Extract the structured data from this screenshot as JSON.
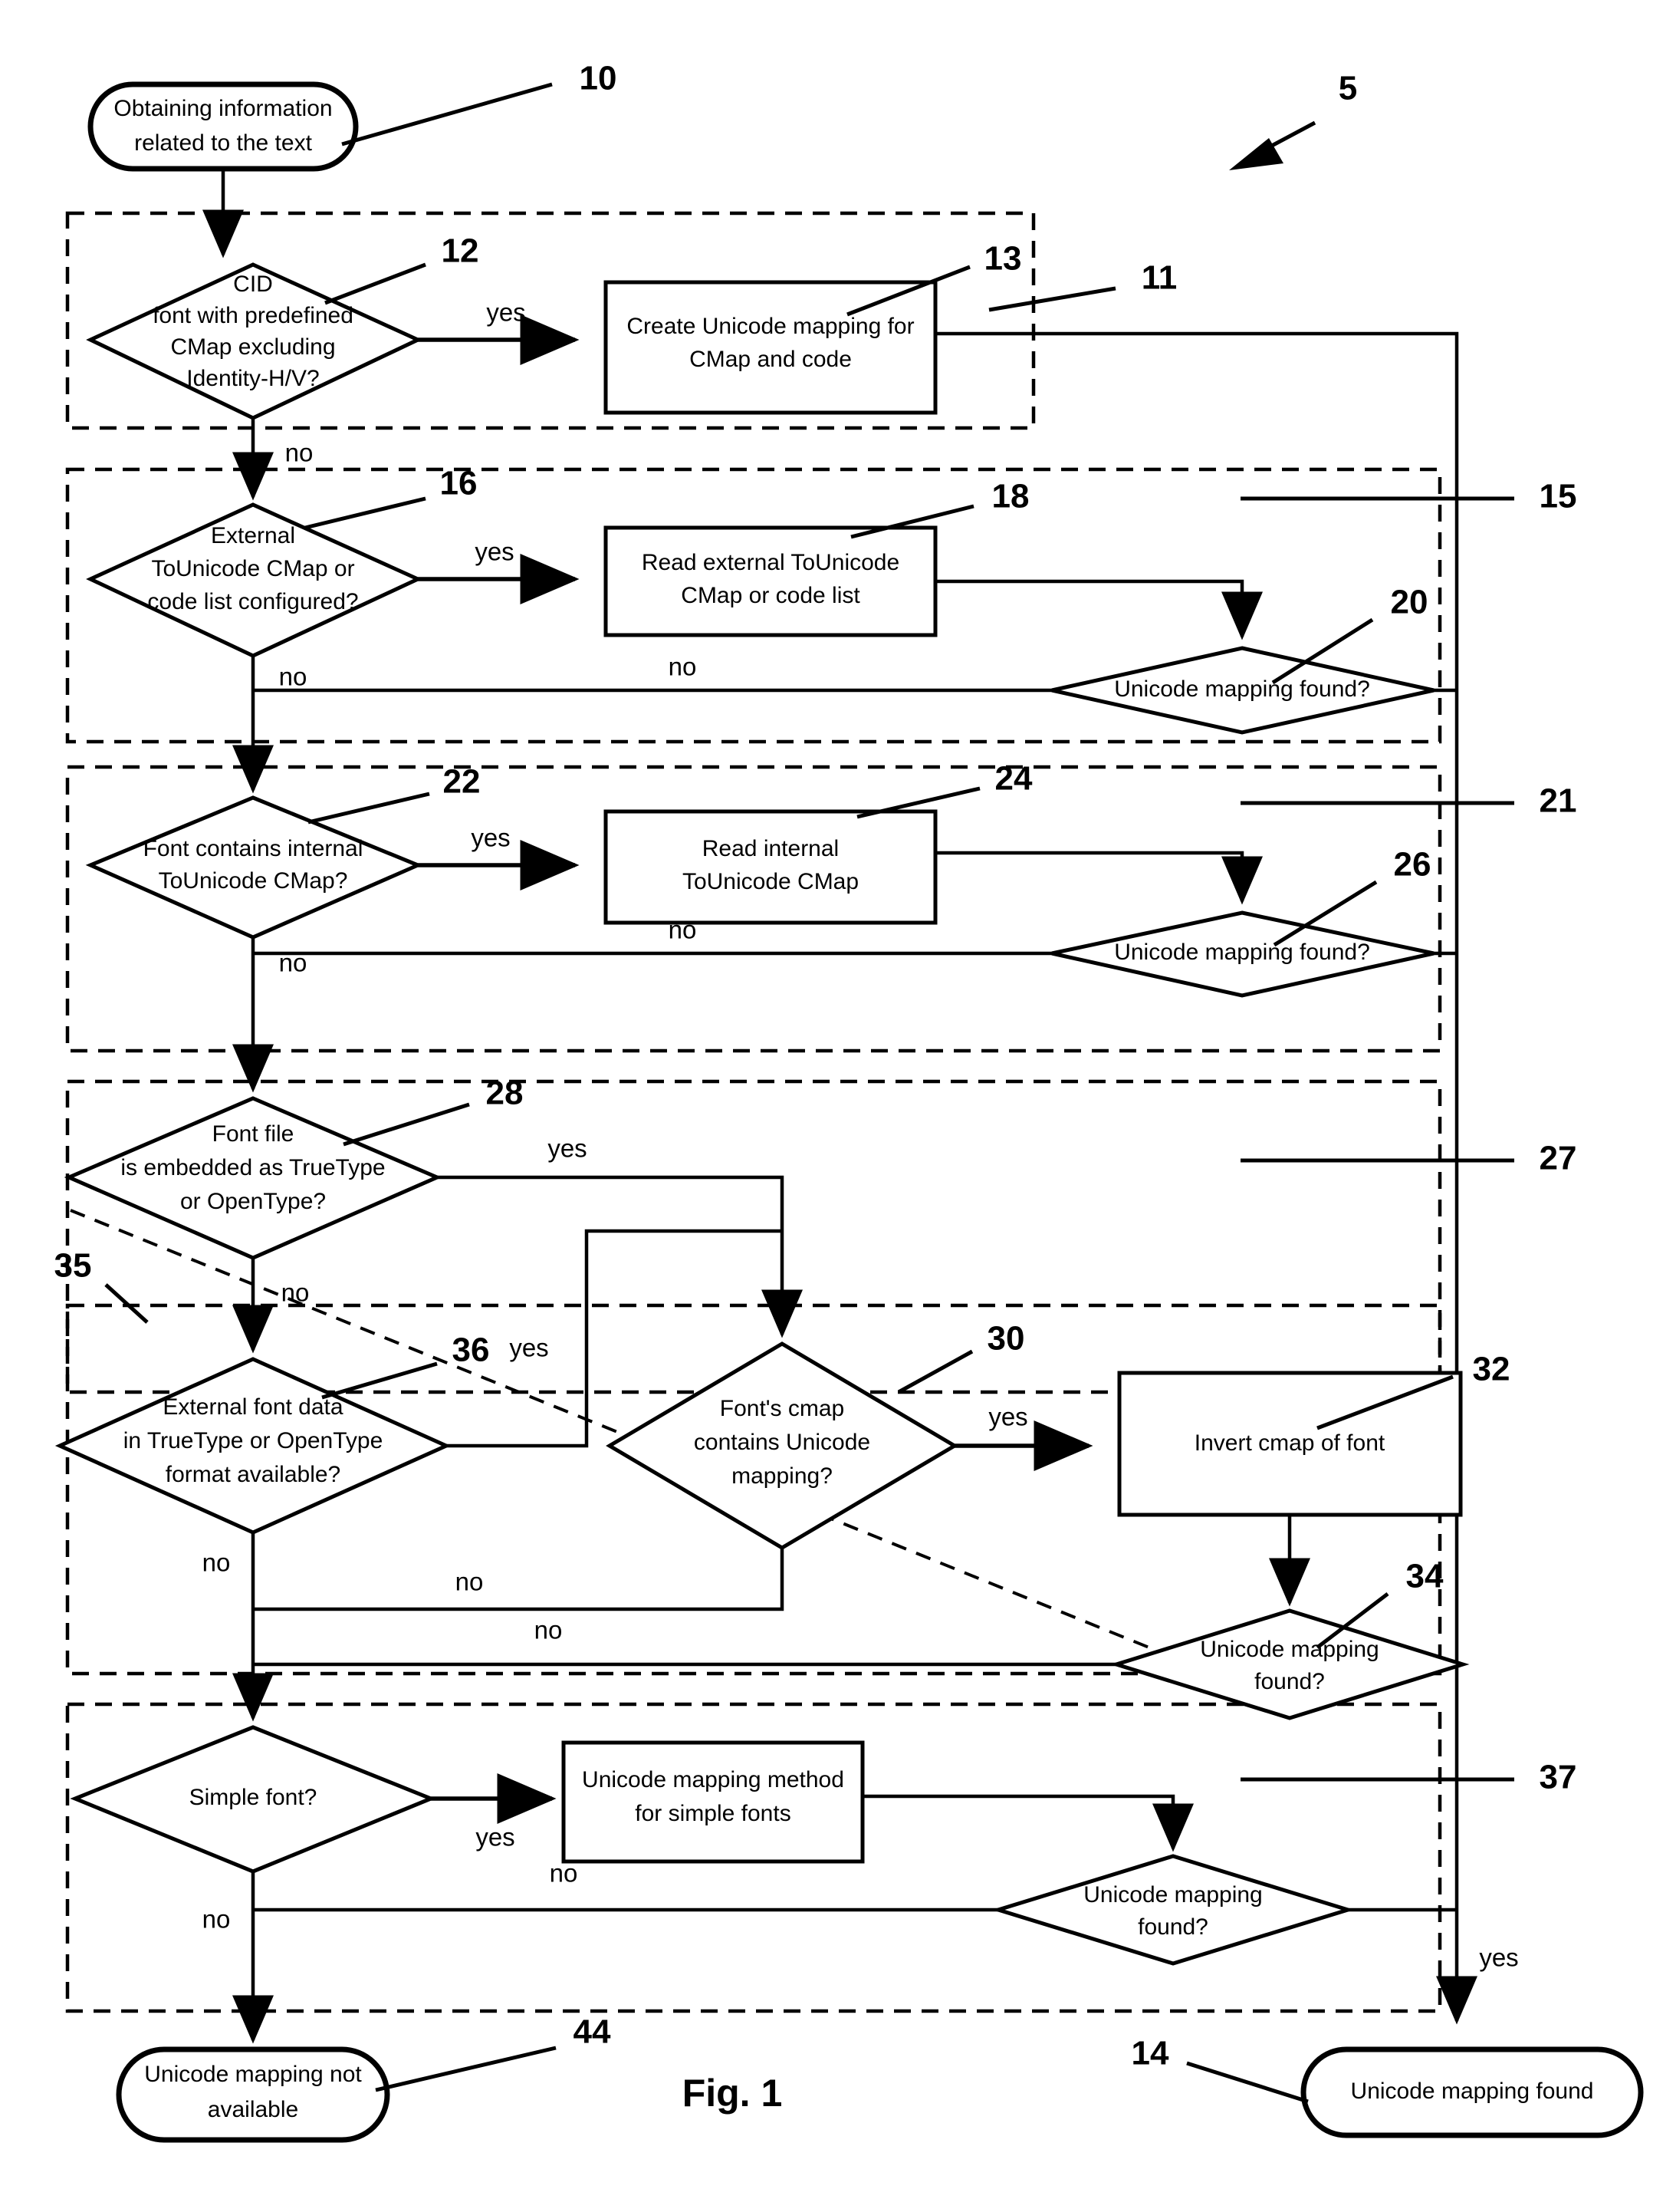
{
  "figure": {
    "caption": "Fig. 1",
    "overall_ref": "5"
  },
  "terminators": [
    {
      "id": "start",
      "ref": "10",
      "lines": [
        "Obtaining information",
        "related to the text"
      ]
    },
    {
      "id": "fail",
      "ref": "44",
      "lines": [
        "Unicode mapping not",
        "available"
      ]
    },
    {
      "id": "success",
      "ref": "14",
      "lines": [
        "Unicode mapping found"
      ]
    }
  ],
  "decisions": [
    {
      "id": "cid",
      "ref": "12",
      "lines": [
        "CID",
        "font with predefined",
        "CMap excluding",
        "Identity-H/V?"
      ]
    },
    {
      "id": "external_cmap",
      "ref": "16",
      "lines": [
        "External",
        "ToUnicode CMap or",
        "code list configured?"
      ]
    },
    {
      "id": "found_20",
      "ref": "20",
      "lines": [
        "Unicode mapping found?"
      ]
    },
    {
      "id": "internal_cmap",
      "ref": "22",
      "lines": [
        "Font contains internal",
        "ToUnicode CMap?"
      ]
    },
    {
      "id": "found_26",
      "ref": "26",
      "lines": [
        "Unicode mapping found?"
      ]
    },
    {
      "id": "embedded",
      "ref": "28",
      "lines": [
        "Font file",
        "is  embedded as  TrueType",
        "or OpenType?"
      ]
    },
    {
      "id": "external_font_data",
      "ref": "36",
      "lines": [
        "External font data",
        "in TrueType or OpenType",
        "format  available?"
      ]
    },
    {
      "id": "font_cmap",
      "ref": "30",
      "lines": [
        "Font's cmap",
        "contains Unicode",
        "mapping?"
      ]
    },
    {
      "id": "found_34",
      "ref": "34",
      "lines": [
        "Unicode mapping",
        "found?"
      ]
    },
    {
      "id": "simple_font",
      "ref": "",
      "lines": [
        "Simple font?"
      ]
    },
    {
      "id": "found_simple",
      "ref": "",
      "lines": [
        "Unicode mapping",
        "found?"
      ]
    }
  ],
  "processes": [
    {
      "id": "create_mapping",
      "ref": "13",
      "lines": [
        "Create Unicode mapping for",
        "CMap and code"
      ]
    },
    {
      "id": "read_external",
      "ref": "18",
      "lines": [
        "Read external ToUnicode",
        "CMap or code list"
      ]
    },
    {
      "id": "read_internal",
      "ref": "24",
      "lines": [
        "Read internal",
        "ToUnicode CMap"
      ]
    },
    {
      "id": "invert_cmap",
      "ref": "32",
      "lines": [
        "Invert cmap of font"
      ]
    },
    {
      "id": "simple_method",
      "ref": "",
      "lines": [
        "Unicode mapping method",
        "for simple fonts"
      ]
    }
  ],
  "group_refs": [
    {
      "id": "group-11",
      "ref": "11"
    },
    {
      "id": "group-15",
      "ref": "15"
    },
    {
      "id": "group-21",
      "ref": "21"
    },
    {
      "id": "group-27",
      "ref": "27"
    },
    {
      "id": "group-35",
      "ref": "35"
    },
    {
      "id": "group-37",
      "ref": "37"
    }
  ],
  "edge_labels": {
    "yes": "yes",
    "no": "no"
  },
  "edges": [
    {
      "from": "cid",
      "to": "create_mapping",
      "label": "yes"
    },
    {
      "from": "cid",
      "to": "external_cmap",
      "label": "no"
    },
    {
      "from": "external_cmap",
      "to": "read_external",
      "label": "yes"
    },
    {
      "from": "external_cmap",
      "to": "internal_cmap",
      "label": "no"
    },
    {
      "from": "found_20",
      "to": "internal_cmap",
      "label": "no"
    },
    {
      "from": "internal_cmap",
      "to": "read_internal",
      "label": "yes"
    },
    {
      "from": "internal_cmap",
      "to": "embedded",
      "label": "no"
    },
    {
      "from": "found_26",
      "to": "embedded",
      "label": "no"
    },
    {
      "from": "embedded",
      "to": "font_cmap",
      "label": "yes"
    },
    {
      "from": "embedded",
      "to": "external_font_data",
      "label": "no"
    },
    {
      "from": "external_font_data",
      "to": "font_cmap",
      "label": "yes"
    },
    {
      "from": "external_font_data",
      "to": "simple_font",
      "label": "no"
    },
    {
      "from": "font_cmap",
      "to": "invert_cmap",
      "label": "yes"
    },
    {
      "from": "font_cmap",
      "to": "simple_font",
      "label": "no"
    },
    {
      "from": "found_34",
      "to": "simple_font",
      "label": "no"
    },
    {
      "from": "simple_font",
      "to": "simple_method",
      "label": "yes"
    },
    {
      "from": "simple_font",
      "to": "fail",
      "label": "no"
    },
    {
      "from": "found_simple",
      "to": "fail",
      "label": "no"
    },
    {
      "from": "found_simple",
      "to": "success",
      "label": "yes"
    }
  ],
  "colors": {
    "stroke": "#000000",
    "background": "#ffffff"
  }
}
